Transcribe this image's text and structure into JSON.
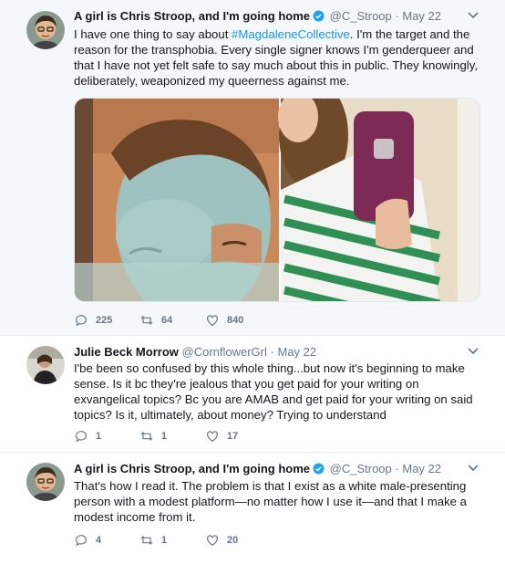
{
  "tweets": [
    {
      "name": "A girl is Chris Stroop, and I'm going home",
      "verified": true,
      "handle": "@C_Stroop",
      "date": "May 22",
      "text_before": "I have one thing to say about ",
      "hashtag": "#MagdaleneCollective",
      "text_after": ". I'm the target and the reason for the transphobia. Every single signer knows I'm genderqueer and that I have not yet felt safe to say much about this in public. They knowingly, deliberately, weaponized my queerness against me.",
      "replies": "225",
      "retweets": "64",
      "likes": "840",
      "media": [
        "photo-face-mask",
        "photo-mirror-selfie"
      ]
    },
    {
      "name": "Julie Beck Morrow",
      "verified": false,
      "handle": "@CornflowerGrl",
      "date": "May 22",
      "text": "I'be been so confused by this whole thing...but now it's beginning to make sense. Is it bc they're jealous that you get paid for your writing on exvangelical topics? Bc you are AMAB and get paid for your writing on said topics? Is it, ultimately, about money? Trying to understand",
      "replies": "1",
      "retweets": "1",
      "likes": "17"
    },
    {
      "name": "A girl is Chris Stroop, and I'm going home",
      "verified": true,
      "handle": "@C_Stroop",
      "date": "May 22",
      "text": "That's how I read it. The problem is that I exist as a white male-presenting person with a modest platform—no matter how I use it—and that I make a modest income from it.",
      "replies": "4",
      "retweets": "1",
      "likes": "20"
    }
  ],
  "separator": "·",
  "colors": {
    "accent": "#1da1f2",
    "link": "#1b95e0",
    "muted": "#657786",
    "highlight_bg": "#f5f8fa"
  },
  "icons": [
    "reply-icon",
    "retweet-icon",
    "like-icon",
    "verified-badge-icon",
    "chevron-down-icon"
  ]
}
